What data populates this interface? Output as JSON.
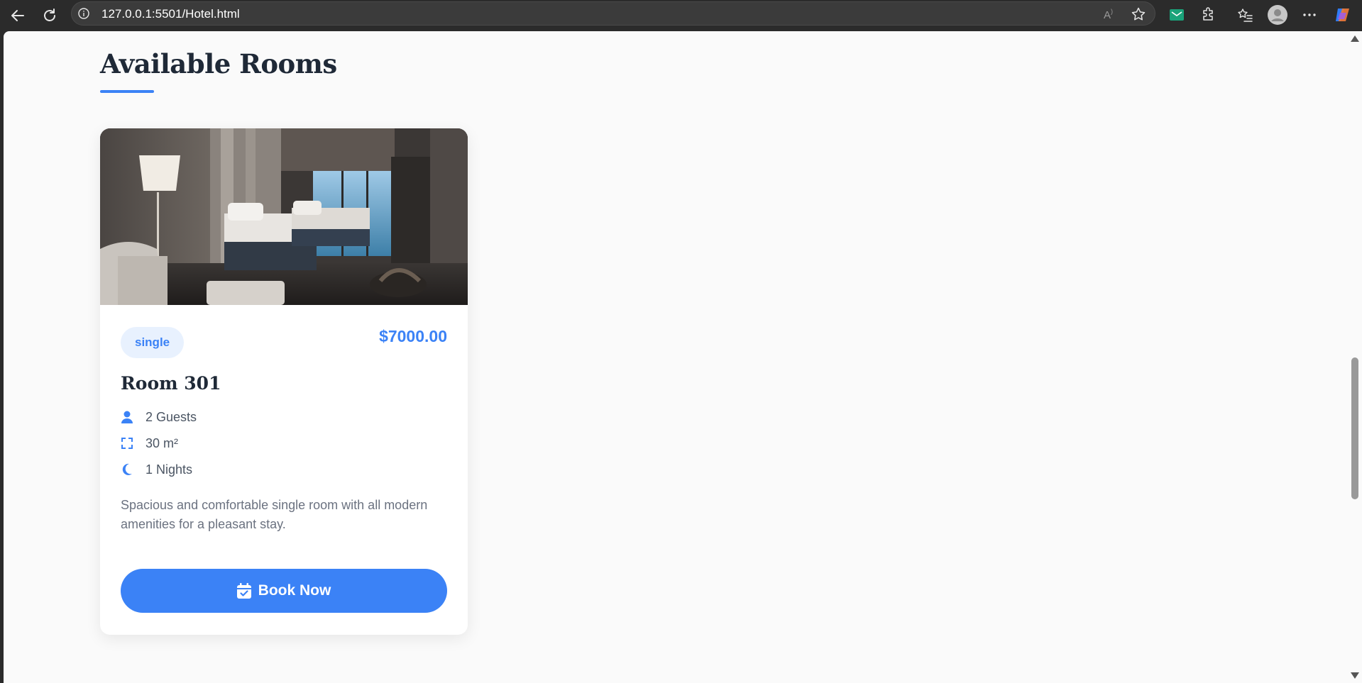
{
  "browser": {
    "url": "127.0.0.1:5501/Hotel.html"
  },
  "page": {
    "heading": "Available Rooms",
    "accent_color": "#3b82f6"
  },
  "room": {
    "type_badge": "single",
    "price": "$7000.00",
    "title": "Room 301",
    "features": [
      {
        "icon": "user-icon",
        "label": "2 Guests"
      },
      {
        "icon": "expand-icon",
        "label": "30 m²"
      },
      {
        "icon": "moon-icon",
        "label": "1 Nights"
      }
    ],
    "description": "Spacious and comfortable single room with all modern amenities for a pleasant stay.",
    "book_label": "Book Now"
  }
}
